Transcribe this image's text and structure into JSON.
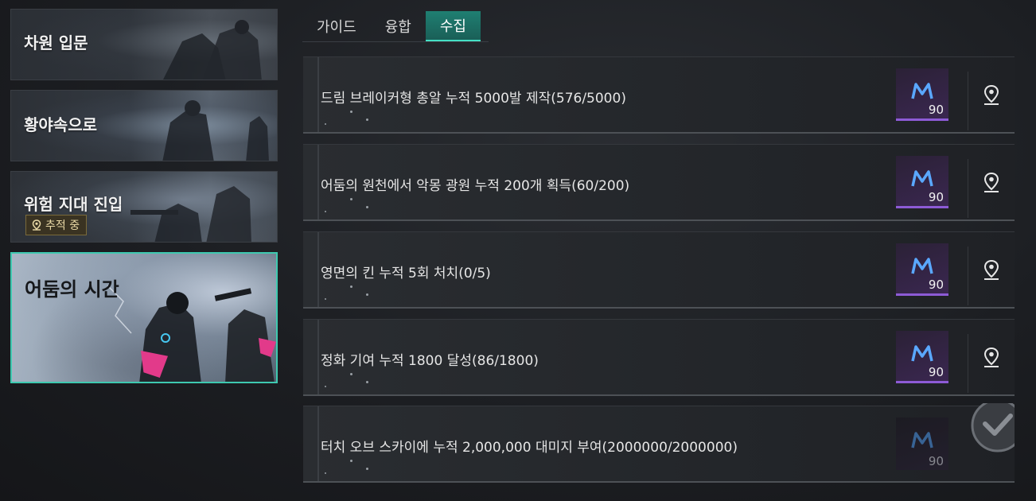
{
  "chapters": [
    {
      "title": "차원 입문"
    },
    {
      "title": "황야속으로"
    },
    {
      "title": "위험 지대 진입",
      "badge": "추적 중"
    },
    {
      "title": "어둠의 시간"
    }
  ],
  "tabs": [
    {
      "label": "가이드"
    },
    {
      "label": "융합"
    },
    {
      "label": "수집"
    }
  ],
  "active_tab": "수집",
  "quests": [
    {
      "description": "드림 브레이커형 총알 누적 5000발 제작(576/5000)",
      "reward_count": "90"
    },
    {
      "description": "어둠의 원천에서 악몽 광원 누적 200개 획득(60/200)",
      "reward_count": "90"
    },
    {
      "description": "영면의 킨 누적 5회 처치(0/5)",
      "reward_count": "90"
    },
    {
      "description": "정화 기여 누적 1800 달성(86/1800)",
      "reward_count": "90"
    },
    {
      "description": "터치 오브 스카이에 누적 2,000,000 대미지 부여(2000000/2000000)",
      "reward_count": "90"
    }
  ],
  "colors": {
    "accent_teal": "#3ec9b0",
    "reward_purple": "#8d5bd6",
    "tracking_gold": "#e9d9a6"
  },
  "icons": {
    "location": "map-pin-icon",
    "reward": "currency-m-logo-icon",
    "completed": "checkmark-icon"
  }
}
